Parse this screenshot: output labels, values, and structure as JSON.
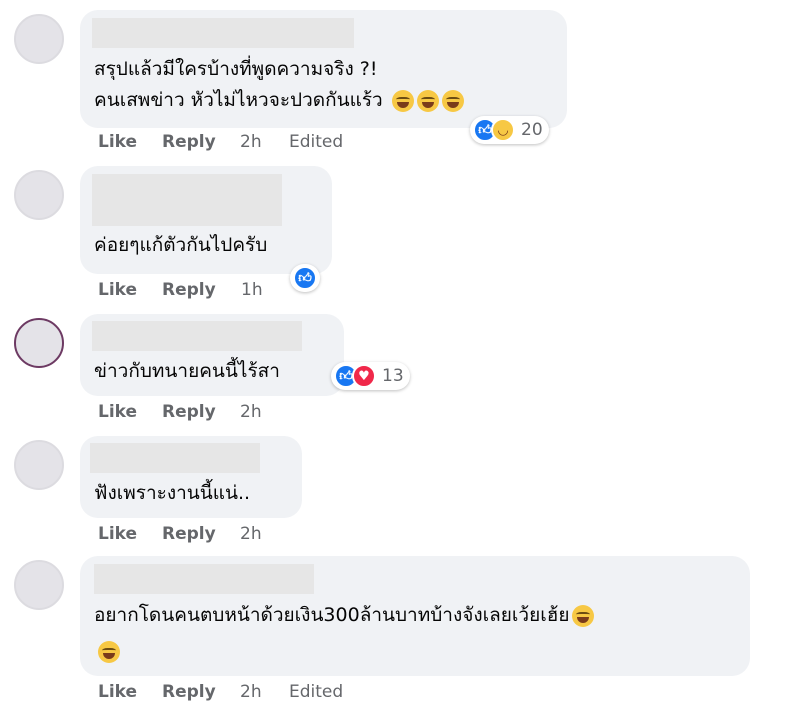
{
  "comments": [
    {
      "text_lines": [
        "สรุปแล้วมีใครบ้างที่พูดความจริง ?!",
        "คนเสพข่าว หัวไม่ไหวจะปวดกันแร้ว"
      ],
      "reaction_count": "20",
      "time": "2h",
      "edited": "Edited"
    },
    {
      "text_lines": [
        "ค่อยๆแก้ตัวกันไปครับ"
      ],
      "time": "1h"
    },
    {
      "text_lines": [
        "ข่าวกับทนายคนนี้ไร้สา"
      ],
      "reaction_count": "13",
      "time": "2h"
    },
    {
      "text_lines": [
        "ฟังเพราะงานนี้แน่.."
      ],
      "time": "2h"
    },
    {
      "text_lines": [
        "อยากโดนคนตบหน้าด้วยเงิน300ล้านบาทบ้างจังเลยเว้ยเฮ้ย"
      ],
      "time": "2h",
      "edited": "Edited"
    }
  ],
  "actions": {
    "like": "Like",
    "reply": "Reply"
  },
  "colors": {
    "bubble": "#f0f2f5",
    "meta": "#65676b",
    "like_blue": "#1877f2",
    "love_red": "#f0284a",
    "haha_yellow": "#f7c844"
  },
  "icons": {
    "like": "thumbs-up-icon",
    "love": "heart-icon",
    "haha": "laughing-face-icon"
  }
}
